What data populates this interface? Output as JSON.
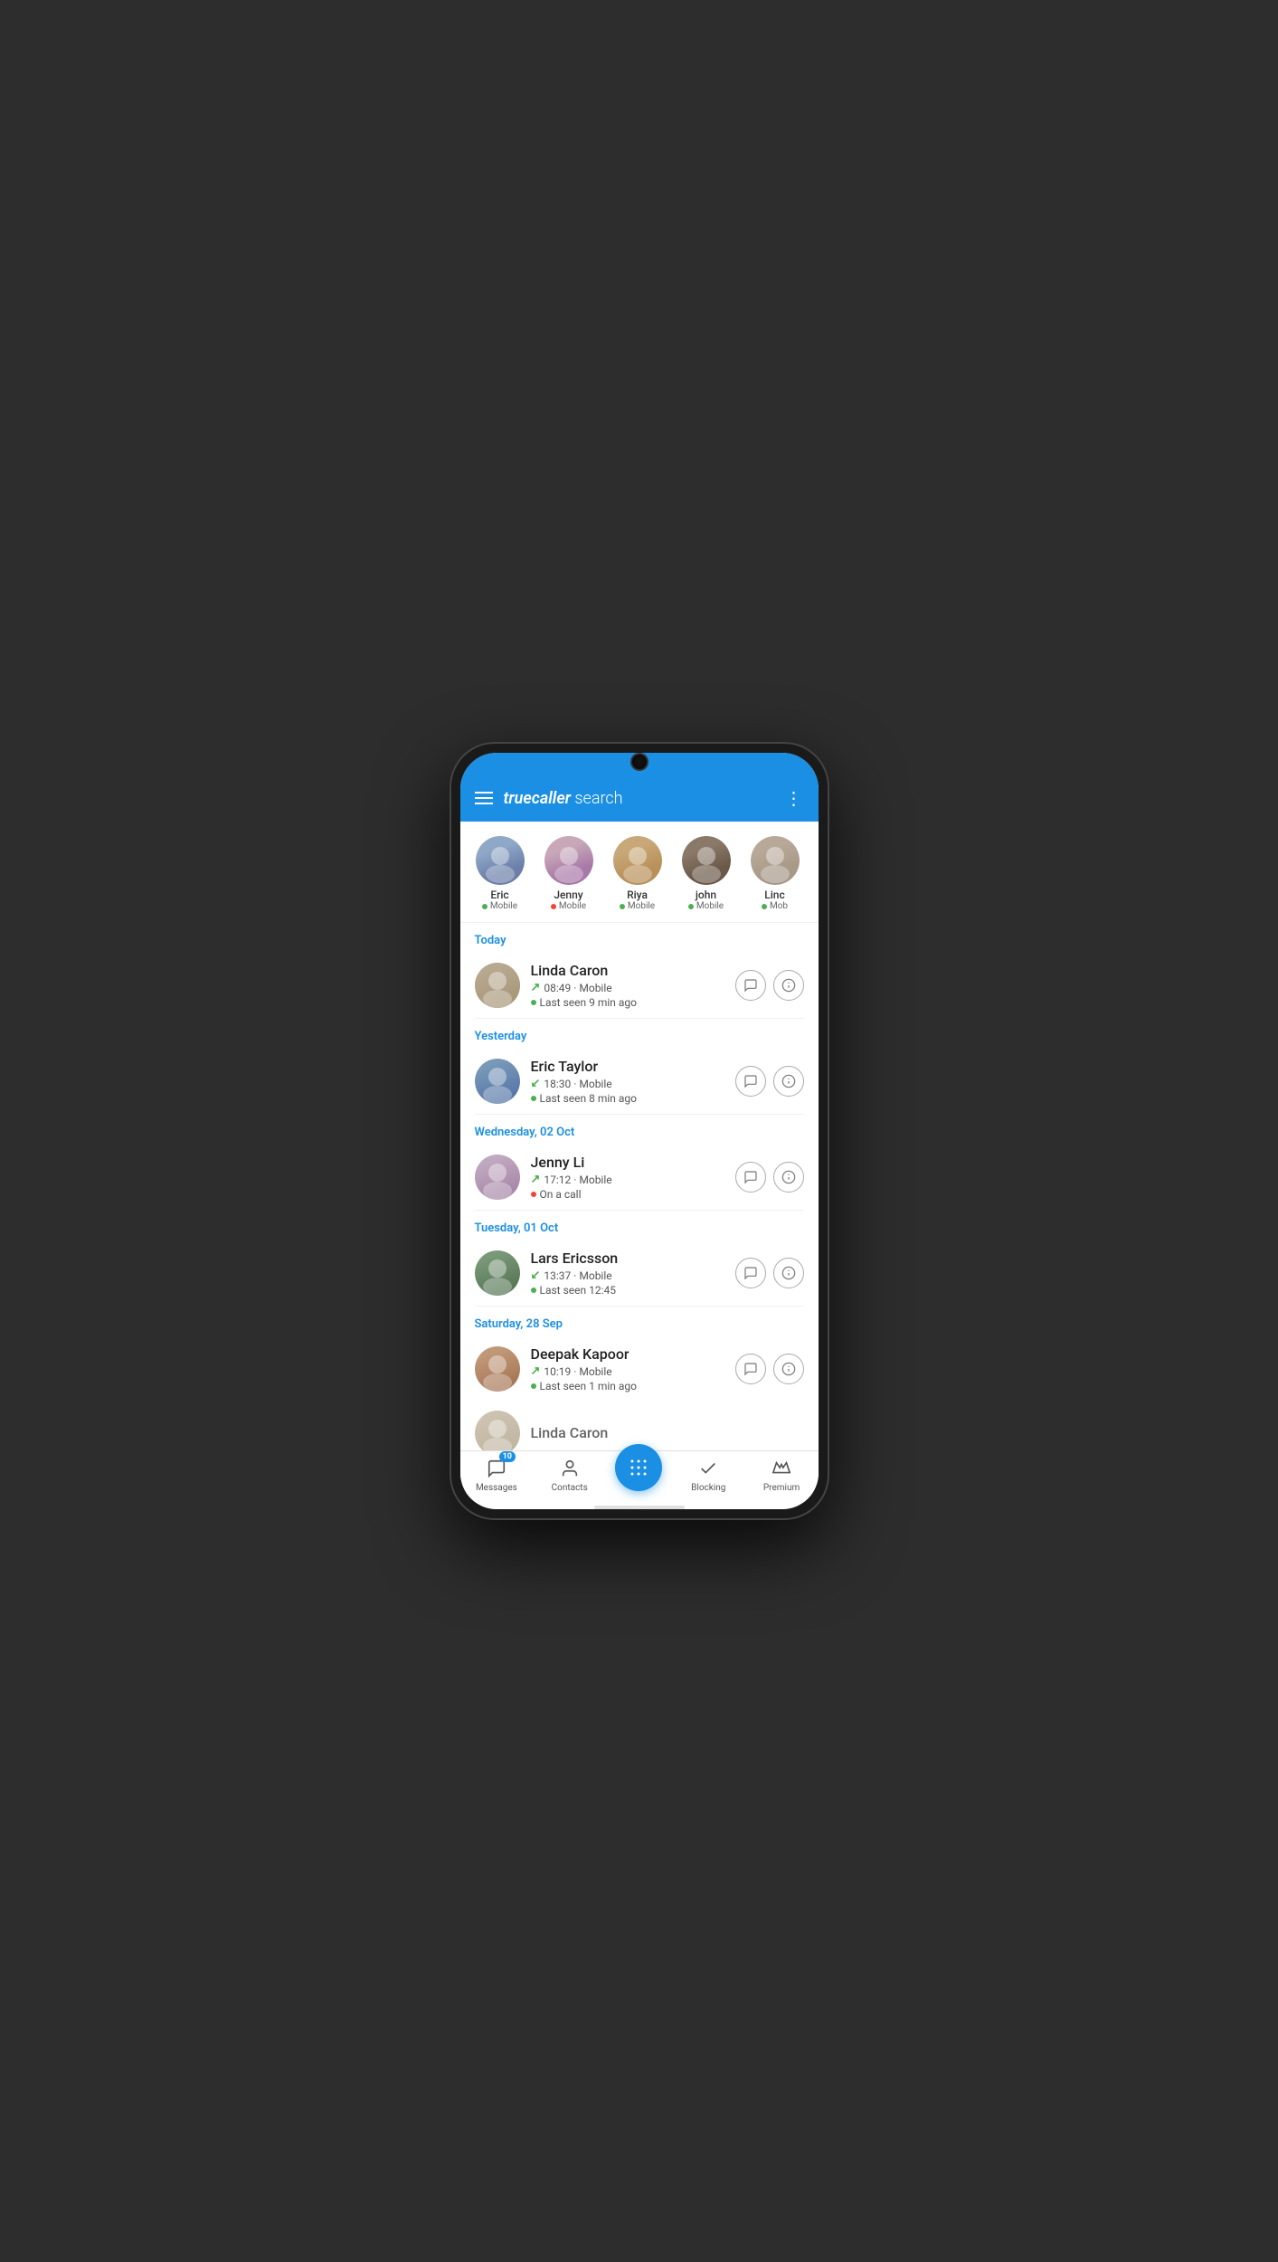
{
  "app": {
    "brand": "truecaller",
    "brand_suffix": "search",
    "more_icon": "⋮"
  },
  "recent_contacts": [
    {
      "id": "eric",
      "name": "Eric",
      "status": "Mobile",
      "status_color": "green",
      "avatar_class": "av-eric-r"
    },
    {
      "id": "jenny",
      "name": "Jenny",
      "status": "Mobile",
      "status_color": "red",
      "avatar_class": "av-jenny"
    },
    {
      "id": "riya",
      "name": "Riya",
      "status": "Mobile",
      "status_color": "green",
      "avatar_class": "av-riya"
    },
    {
      "id": "john",
      "name": "john",
      "status": "Mobile",
      "status_color": "green",
      "avatar_class": "av-john"
    },
    {
      "id": "linc",
      "name": "Linc",
      "status": "Mob",
      "status_color": "green",
      "avatar_class": "av-linc"
    }
  ],
  "sections": [
    {
      "label": "Today",
      "calls": [
        {
          "id": "linda-caron",
          "name": "Linda Caron",
          "arrow": "↗",
          "arrow_type": "outgoing",
          "time": "08:49 · Mobile",
          "status_dot": "green",
          "status_text": "Last seen 9 min ago",
          "avatar_class": "av-linda-main"
        }
      ]
    },
    {
      "label": "Yesterday",
      "calls": [
        {
          "id": "eric-taylor",
          "name": "Eric Taylor",
          "arrow": "↙",
          "arrow_type": "incoming",
          "time": "18:30 · Mobile",
          "status_dot": "green",
          "status_text": "Last seen 8 min ago",
          "avatar_class": "av-eric-main"
        }
      ]
    },
    {
      "label": "Wednesday, 02 Oct",
      "calls": [
        {
          "id": "jenny-li",
          "name": "Jenny Li",
          "arrow": "↗",
          "arrow_type": "outgoing",
          "time": "17:12 · Mobile",
          "status_dot": "red",
          "status_text": "On a call",
          "avatar_class": "av-jenny-main"
        }
      ]
    },
    {
      "label": "Tuesday, 01 Oct",
      "calls": [
        {
          "id": "lars-ericsson",
          "name": "Lars Ericsson",
          "arrow": "↙",
          "arrow_type": "incoming",
          "time": "13:37 · Mobile",
          "status_dot": "green",
          "status_text": "Last seen 12:45",
          "avatar_class": "av-lars-main"
        }
      ]
    },
    {
      "label": "Saturday, 28 Sep",
      "calls": [
        {
          "id": "deepak-kapoor",
          "name": "Deepak Kapoor",
          "arrow": "↗",
          "arrow_type": "outgoing",
          "time": "10:19 · Mobile",
          "status_dot": "green",
          "status_text": "Last seen 1 min ago",
          "avatar_class": "av-deepak-main"
        },
        {
          "id": "linda-caron-2",
          "name": "Linda Caron",
          "arrow": "",
          "arrow_type": "",
          "time": "",
          "status_dot": "",
          "status_text": "",
          "avatar_class": "av-linda2-main"
        }
      ]
    }
  ],
  "bottom_nav": {
    "items": [
      {
        "id": "messages",
        "label": "Messages",
        "badge": "10",
        "icon": "message"
      },
      {
        "id": "contacts",
        "label": "Contacts",
        "icon": "person"
      },
      {
        "id": "dialpad",
        "label": "",
        "icon": "dialpad",
        "is_fab": true
      },
      {
        "id": "blocking",
        "label": "Blocking",
        "icon": "block"
      },
      {
        "id": "premium",
        "label": "Premium",
        "icon": "crown"
      }
    ]
  },
  "action_buttons": {
    "chat": "💬",
    "info": "ℹ"
  }
}
